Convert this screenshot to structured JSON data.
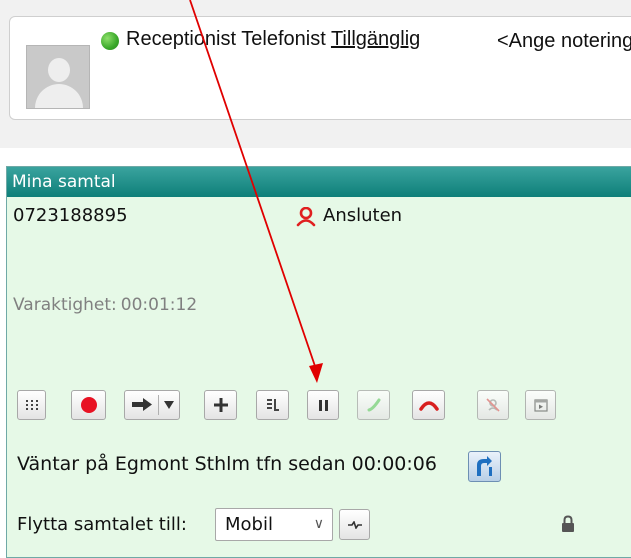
{
  "status": {
    "role_text": "Receptionist Telefonist",
    "presence": "Tillgänglig",
    "note_placeholder": "<Ange notering"
  },
  "calls_panel": {
    "title": "Mina samtal",
    "number": "0723188895",
    "connection_status": "Ansluten",
    "duration_label": "Varaktighet:",
    "duration_value": "00:01:12",
    "toolbar": [
      {
        "name": "dialpad-button",
        "icon": "dialpad-icon"
      },
      {
        "name": "record-button",
        "icon": "record-icon"
      },
      {
        "name": "transfer-button",
        "icon": "transfer-arrow-icon"
      },
      {
        "name": "add-call-button",
        "icon": "plus-icon"
      },
      {
        "name": "notes-button",
        "icon": "notes-icon"
      },
      {
        "name": "hold-button",
        "icon": "pause-icon"
      },
      {
        "name": "answer-button",
        "icon": "phone-answer-icon",
        "disabled": true
      },
      {
        "name": "hangup-button",
        "icon": "phone-hangup-icon"
      },
      {
        "name": "mute-button",
        "icon": "mute-icon",
        "disabled": true
      },
      {
        "name": "screen-button",
        "icon": "screen-icon",
        "disabled": true
      }
    ],
    "waiting_text": "Väntar på Egmont Sthlm tfn sedan",
    "waiting_time": "00:00:06",
    "move_label": "Flytta samtalet till:",
    "move_selected": "Mobil"
  },
  "colors": {
    "panel_bg": "#e6f9e7",
    "header_bg": "#0e7f79",
    "record_red": "#e81123",
    "hangup_red": "#d81e1e",
    "presence_green": "#3aa82a",
    "annotation_red": "#e00000"
  }
}
